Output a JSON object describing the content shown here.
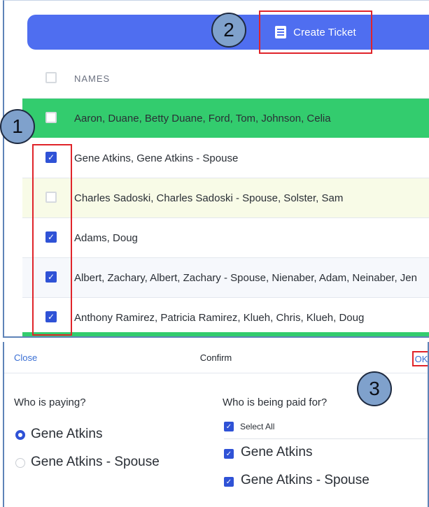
{
  "toolbar": {
    "create_ticket_label": "Create Ticket",
    "create_ticket_icon": "document-icon"
  },
  "table": {
    "header": "NAMES",
    "rows": [
      {
        "names": "Aaron, Duane, Betty Duane, Ford, Tom, Johnson, Celia",
        "checked": false,
        "highlight": "green"
      },
      {
        "names": "Gene Atkins, Gene Atkins - Spouse",
        "checked": true,
        "highlight": "none"
      },
      {
        "names": "Charles Sadoski, Charles Sadoski - Spouse, Solster, Sam",
        "checked": false,
        "highlight": "yellow"
      },
      {
        "names": "Adams, Doug",
        "checked": true,
        "highlight": "none"
      },
      {
        "names": "Albert, Zachary, Albert, Zachary - Spouse, Nienaber, Adam, Neinaber, Jen",
        "checked": true,
        "highlight": "light"
      },
      {
        "names": "Anthony Ramirez, Patricia Ramirez, Klueh, Chris, Klueh, Doug",
        "checked": true,
        "highlight": "none"
      }
    ]
  },
  "callouts": {
    "one": "1",
    "two": "2",
    "three": "3"
  },
  "confirm": {
    "close_label": "Close",
    "title": "Confirm",
    "ok_label": "OK",
    "paying_question": "Who is paying?",
    "paying_options": [
      {
        "label": "Gene Atkins",
        "selected": true
      },
      {
        "label": "Gene Atkins - Spouse",
        "selected": false
      }
    ],
    "paid_for_question": "Who is being paid for?",
    "select_all_label": "Select All",
    "paid_for_options": [
      {
        "label": "Gene Atkins",
        "checked": true
      },
      {
        "label": "Gene Atkins - Spouse",
        "checked": true
      }
    ]
  },
  "colors": {
    "accent": "#4f6ef0",
    "checkbox": "#2f52d6",
    "highlight_green": "#33cc6e",
    "annotation_red": "#e0242a",
    "callout_fill": "#7fa1cc"
  }
}
